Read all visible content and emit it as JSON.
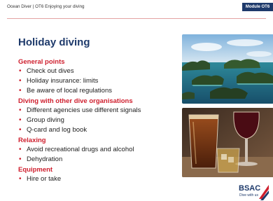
{
  "header": {
    "left_text": "Ocean Diver  |  OT6 Enjoying your diving",
    "module_label": "Module OT6"
  },
  "title": "Holiday diving",
  "sections": [
    {
      "heading": "General points",
      "items": [
        "Check out dives",
        "Holiday insurance: limits",
        "Be aware of local regulations"
      ]
    },
    {
      "heading": "Diving with other dive organisations",
      "items": [
        "Different agencies use different signals",
        "Group diving",
        "Q-card and log book"
      ]
    },
    {
      "heading": "Relaxing",
      "items": [
        "Avoid recreational drugs and alcohol",
        "Dehydration"
      ]
    },
    {
      "heading": "Equipment",
      "items": [
        "Hire or take"
      ]
    }
  ],
  "logo": {
    "text": "BSAC",
    "subtext": "Dive with us"
  },
  "colors": {
    "navy": "#1e3a6b",
    "red": "#cf1f2e"
  },
  "images": [
    "tropical-islands-photo",
    "drinks-glasses-photo"
  ]
}
